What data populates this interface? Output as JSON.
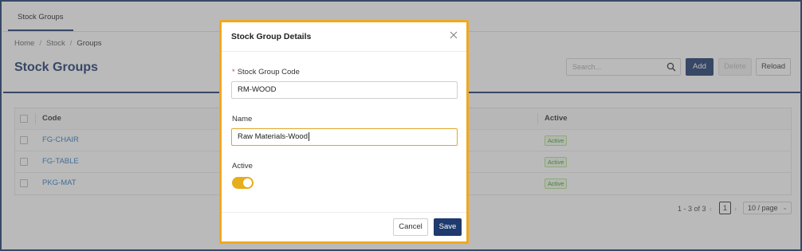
{
  "tabs": [
    {
      "label": "Stock Groups"
    }
  ],
  "breadcrumb": [
    "Home",
    "Stock",
    "Groups"
  ],
  "page_title": "Stock Groups",
  "search": {
    "placeholder": "Search..."
  },
  "toolbar": {
    "add_label": "Add",
    "delete_label": "Delete",
    "reload_label": "Reload"
  },
  "table": {
    "columns": [
      "Code",
      "Active"
    ],
    "rows": [
      {
        "code": "FG-CHAIR",
        "active": "Active"
      },
      {
        "code": "FG-TABLE",
        "active": "Active"
      },
      {
        "code": "PKG-MAT",
        "active": "Active"
      }
    ]
  },
  "pagination": {
    "range_text": "1 - 3 of 3",
    "current_page": "1",
    "page_size": "10 / page"
  },
  "modal": {
    "title": "Stock Group Details",
    "code_label": "Stock Group Code",
    "code_value": "RM-WOOD",
    "name_label": "Name",
    "name_value": "Raw Materials-Wood",
    "active_label": "Active",
    "active_on": true,
    "cancel_label": "Cancel",
    "save_label": "Save"
  },
  "colors": {
    "brand": "#1e3a6e",
    "accent": "#f2a81d",
    "link": "#2f7fc1",
    "success": "#3a9a2a"
  },
  "icons": [
    "search-icon",
    "close-icon",
    "chevron-left-icon",
    "chevron-right-icon",
    "chevron-down-icon"
  ]
}
